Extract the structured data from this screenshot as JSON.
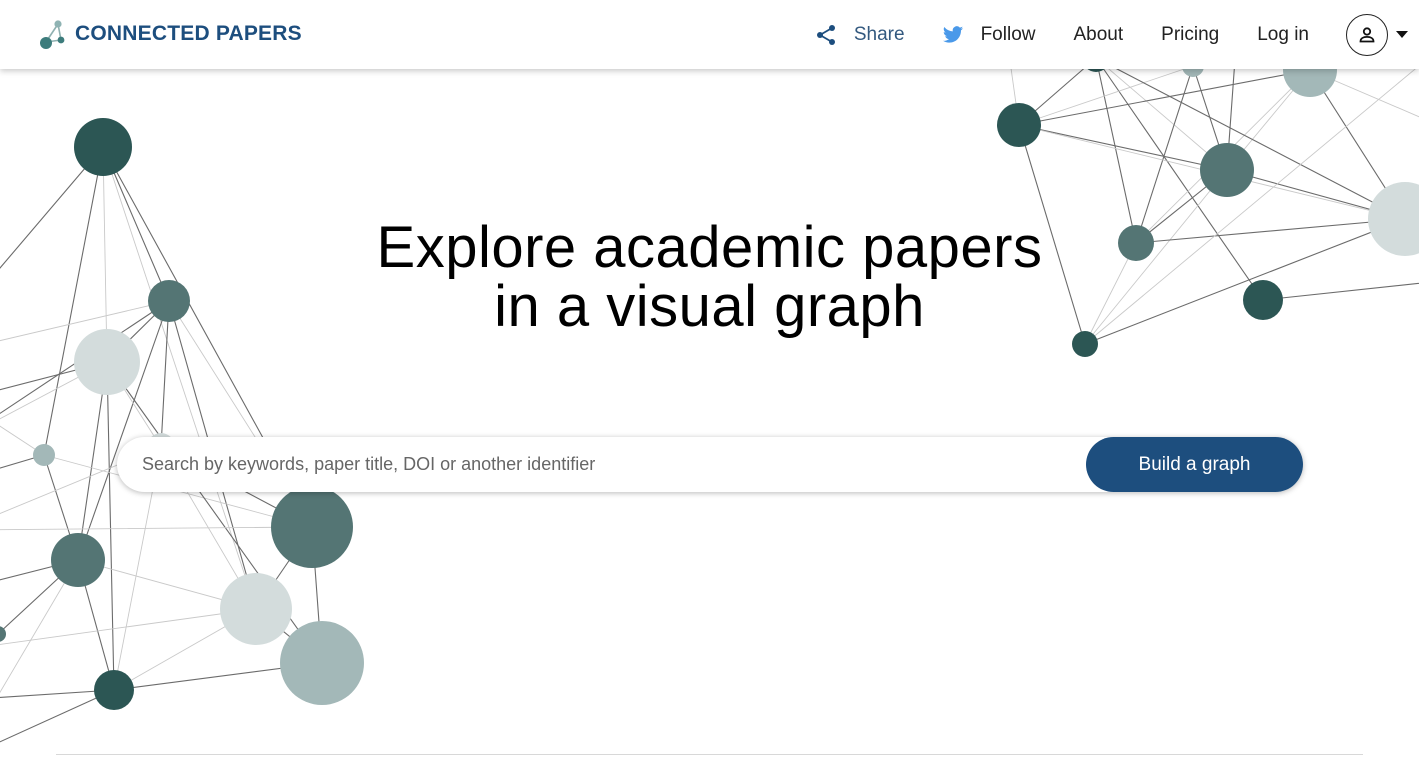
{
  "brand": {
    "name": "CONNECTED PAPERS",
    "color": "#1d4e7e"
  },
  "nav": {
    "share": {
      "label": "Share",
      "icon": "share-icon"
    },
    "follow": {
      "label": "Follow",
      "icon": "twitter-bird-icon"
    },
    "about": {
      "label": "About"
    },
    "pricing": {
      "label": "Pricing"
    },
    "login": {
      "label": "Log in"
    },
    "account": {
      "icon": "user-icon",
      "dropdown_icon": "caret-down-icon"
    }
  },
  "hero": {
    "title_line1": "Explore academic papers",
    "title_line2": "in a visual graph"
  },
  "search": {
    "placeholder": "Search by keywords, paper title, DOI or another identifier",
    "value": "",
    "button_label": "Build a graph"
  },
  "colors": {
    "accent": "#1d4e7e",
    "node_dark": "#2c5654",
    "node_mid": "#547574",
    "node_light": "#a3b8b8",
    "node_pale": "#d3dcdc",
    "twitter": "#4a99e9"
  }
}
